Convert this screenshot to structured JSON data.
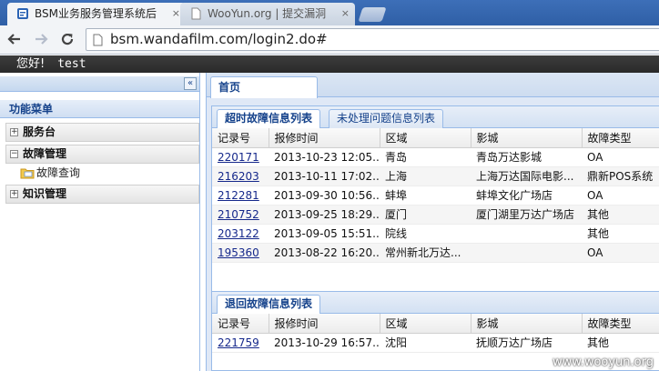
{
  "browser": {
    "tabs": [
      {
        "title": "BSM业务服务管理系统后",
        "active": true
      },
      {
        "title": "WooYun.org | 提交漏洞",
        "active": false
      }
    ],
    "close_glyph": "×",
    "address": "bsm.wandafilm.com/login2.do#"
  },
  "header": {
    "greeting": "您好!",
    "username": "test"
  },
  "sidebar": {
    "collapse_glyph": "«",
    "menu_title": "功能菜单",
    "groups": [
      {
        "label": "服务台",
        "expander": "+"
      },
      {
        "label": "故障管理",
        "expander": "−",
        "children": [
          {
            "label": "故障查询"
          }
        ]
      },
      {
        "label": "知识管理",
        "expander": "+"
      }
    ]
  },
  "main": {
    "tab": "首页",
    "panel1": {
      "tabs": [
        "超时故障信息列表",
        "未处理问题信息列表"
      ],
      "columns": [
        "记录号",
        "报修时间",
        "区域",
        "影城",
        "故障类型"
      ],
      "rows": [
        {
          "id": "220171",
          "time": "2013-10-23 12:05...",
          "region": "青岛",
          "cinema": "青岛万达影城",
          "type": "OA"
        },
        {
          "id": "216203",
          "time": "2013-10-11 17:02...",
          "region": "上海",
          "cinema": "上海万达国际电影...",
          "type": "鼎新POS系统"
        },
        {
          "id": "212281",
          "time": "2013-09-30 10:56...",
          "region": "蚌埠",
          "cinema": "蚌埠文化广场店",
          "type": "OA"
        },
        {
          "id": "210752",
          "time": "2013-09-25 18:29...",
          "region": "厦门",
          "cinema": "厦门湖里万达广场店",
          "type": "其他"
        },
        {
          "id": "203122",
          "time": "2013-09-05 15:51...",
          "region": "院线",
          "cinema": "",
          "type": "其他"
        },
        {
          "id": "195360",
          "time": "2013-08-22 16:20...",
          "region": "常州新北万达...",
          "cinema": "",
          "type": "OA"
        }
      ],
      "scroll_arrow": "◄",
      "scroll_grip": "|||"
    },
    "panel2": {
      "tab": "退回故障信息列表",
      "columns": [
        "记录号",
        "报修时间",
        "区域",
        "影城",
        "故障类型"
      ],
      "rows": [
        {
          "id": "221759",
          "time": "2013-10-29 16:57...",
          "region": "沈阳",
          "cinema": "抚顺万达广场店",
          "type": "其他"
        }
      ]
    }
  },
  "watermark": "www.wooyun.org",
  "colors": {
    "accent": "#15428b",
    "panel_border": "#99bbe8",
    "header_bg": "#2a2a2a"
  }
}
